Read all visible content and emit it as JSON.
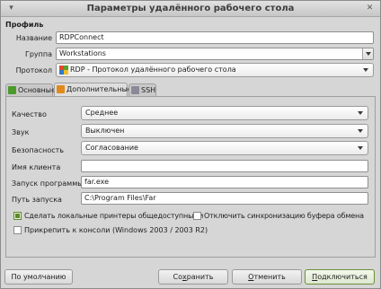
{
  "window": {
    "title": "Параметры удалённого рабочего стола"
  },
  "profile": {
    "section_title": "Профиль",
    "name_label": "Название",
    "name_value": "RDPConnect",
    "group_label": "Группа",
    "group_value": "Workstations",
    "protocol_label": "Протокол",
    "protocol_value": "RDP - Протокол удалённого рабочего стола"
  },
  "tabs": [
    {
      "label": "Основные",
      "icon": "green-tab-icon",
      "color": "#4a9a2c"
    },
    {
      "label": "Дополнительные",
      "icon": "orange-tab-icon",
      "color": "#e08a1c"
    },
    {
      "label": "SSH",
      "icon": "ssh-grid-icon",
      "color": "#8a8a9a"
    }
  ],
  "advanced": {
    "quality_label": "Качество",
    "quality_value": "Среднее",
    "sound_label": "Звук",
    "sound_value": "Выключен",
    "security_label": "Безопасность",
    "security_value": "Согласование",
    "client_name_label": "Имя клиента",
    "client_name_value": "",
    "startup_program_label": "Запуск программы",
    "startup_program_value": "far.exe",
    "startup_path_label": "Путь запуска",
    "startup_path_value": "C:\\Program Files\\Far",
    "share_printers_label": "Сделать локальные принтеры общедоступными",
    "share_printers_checked": true,
    "disable_clipboard_label": "Отключить синхронизацию буфера обмена",
    "disable_clipboard_checked": false,
    "attach_console_label": "Прикрепить к консоли (Windows 2003 / 2003 R2)",
    "attach_console_checked": false
  },
  "buttons": {
    "default_label": "По умолчанию",
    "save_pre": "Со",
    "save_u": "х",
    "save_post": "ранить",
    "cancel_pre": "",
    "cancel_u": "О",
    "cancel_post": "тменить",
    "connect_pre": "",
    "connect_u": "П",
    "connect_post": "одключиться"
  },
  "colors": {
    "accent_green": "#5e8a2c"
  }
}
